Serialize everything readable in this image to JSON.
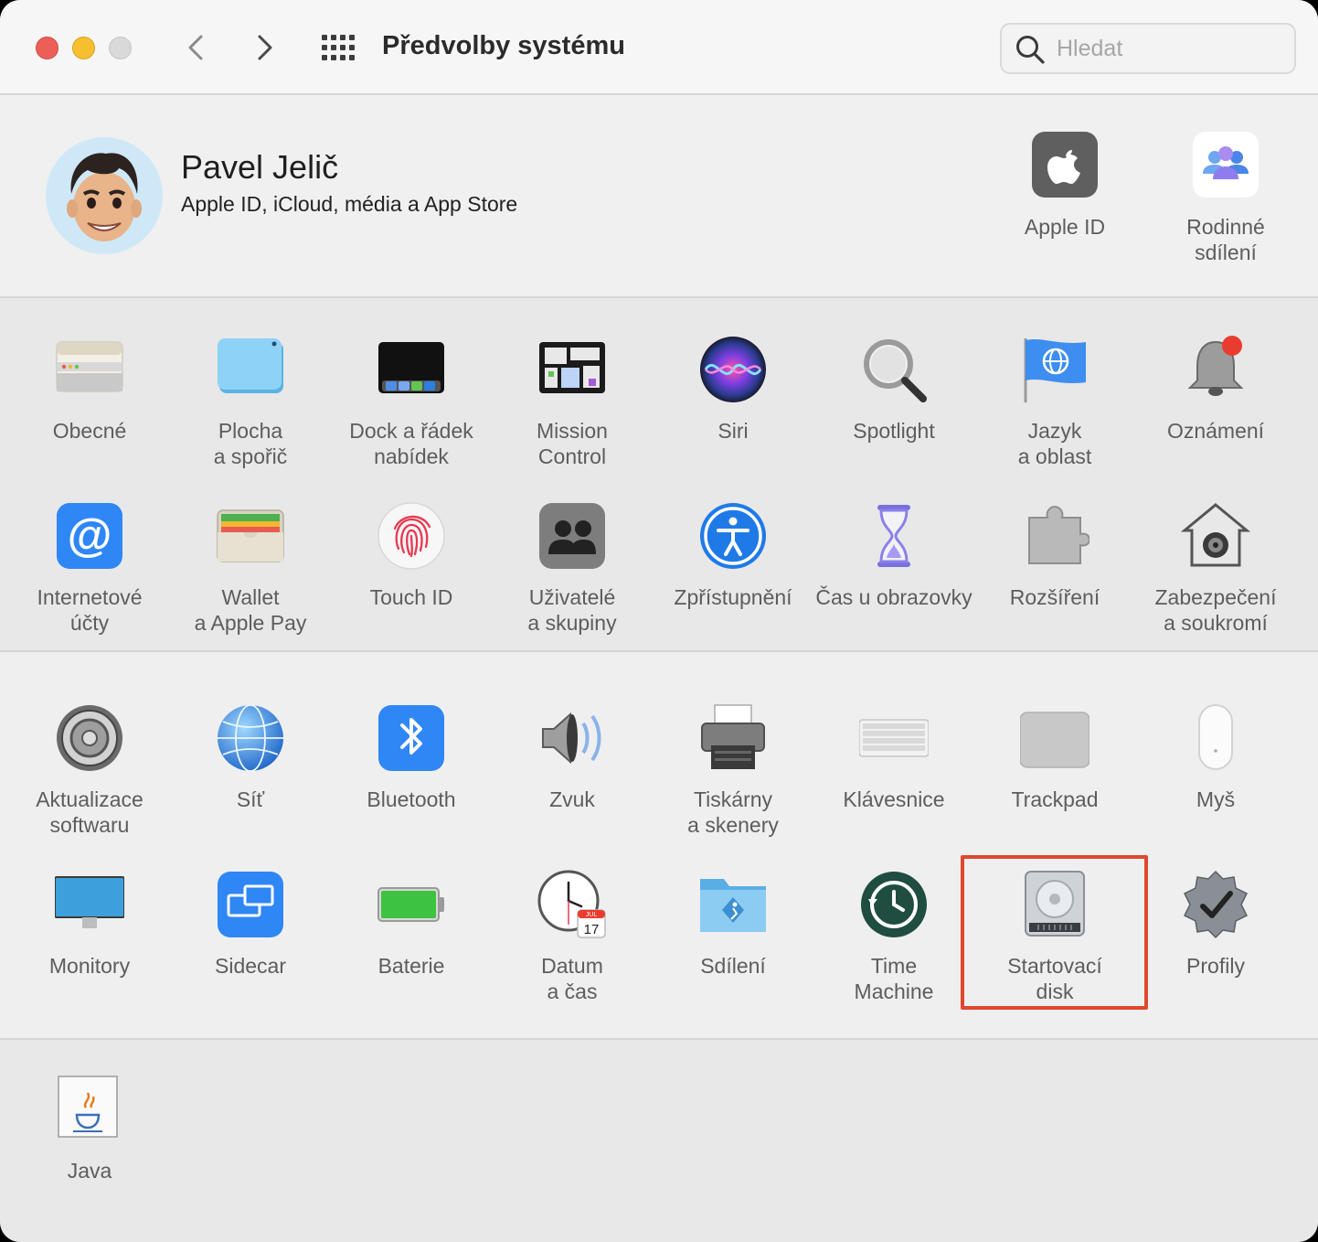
{
  "window": {
    "title": "Předvolby systému",
    "search_placeholder": "Hledat"
  },
  "account": {
    "name": "Pavel Jelič",
    "subtitle": "Apple ID, iCloud, média a App Store",
    "apple_id_label": "Apple ID",
    "family_label": "Rodinné\nsdílení"
  },
  "section1": [
    {
      "label": "Obecné",
      "icon": "general-icon"
    },
    {
      "label": "Plocha\na spořič",
      "icon": "desktop-icon"
    },
    {
      "label": "Dock a řádek\nnabídek",
      "icon": "dock-icon"
    },
    {
      "label": "Mission\nControl",
      "icon": "mission-control-icon"
    },
    {
      "label": "Siri",
      "icon": "siri-icon"
    },
    {
      "label": "Spotlight",
      "icon": "spotlight-icon"
    },
    {
      "label": "Jazyk\na oblast",
      "icon": "language-icon"
    },
    {
      "label": "Oznámení",
      "icon": "notifications-icon"
    },
    {
      "label": "Internetové\núčty",
      "icon": "internet-accounts-icon"
    },
    {
      "label": "Wallet\na Apple Pay",
      "icon": "wallet-icon"
    },
    {
      "label": "Touch ID",
      "icon": "touch-id-icon"
    },
    {
      "label": "Uživatelé\na skupiny",
      "icon": "users-icon"
    },
    {
      "label": "Zpřístupnění",
      "icon": "accessibility-icon"
    },
    {
      "label": "Čas u obrazovky",
      "icon": "screen-time-icon"
    },
    {
      "label": "Rozšíření",
      "icon": "extensions-icon"
    },
    {
      "label": "Zabezpečení\na soukromí",
      "icon": "security-icon"
    }
  ],
  "section2": [
    {
      "label": "Aktualizace\nsoftwaru",
      "icon": "software-update-icon"
    },
    {
      "label": "Síť",
      "icon": "network-icon"
    },
    {
      "label": "Bluetooth",
      "icon": "bluetooth-icon"
    },
    {
      "label": "Zvuk",
      "icon": "sound-icon"
    },
    {
      "label": "Tiskárny\na skenery",
      "icon": "printer-icon"
    },
    {
      "label": "Klávesnice",
      "icon": "keyboard-icon"
    },
    {
      "label": "Trackpad",
      "icon": "trackpad-icon"
    },
    {
      "label": "Myš",
      "icon": "mouse-icon"
    },
    {
      "label": "Monitory",
      "icon": "displays-icon"
    },
    {
      "label": "Sidecar",
      "icon": "sidecar-icon"
    },
    {
      "label": "Baterie",
      "icon": "battery-icon"
    },
    {
      "label": "Datum\na čas",
      "icon": "date-time-icon"
    },
    {
      "label": "Sdílení",
      "icon": "sharing-icon"
    },
    {
      "label": "Time\nMachine",
      "icon": "time-machine-icon"
    },
    {
      "label": "Startovací\ndisk",
      "icon": "startup-disk-icon"
    },
    {
      "label": "Profily",
      "icon": "profiles-icon"
    }
  ],
  "section3": [
    {
      "label": "Java",
      "icon": "java-icon"
    }
  ],
  "calendar": {
    "month": "JUL",
    "day": "17"
  }
}
